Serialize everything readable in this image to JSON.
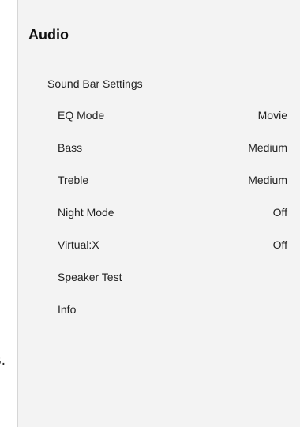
{
  "background": {
    "fragment_text": "s."
  },
  "panel": {
    "title": "Audio",
    "section_header": "Sound Bar Settings",
    "items": [
      {
        "label": "EQ Mode",
        "value": "Movie"
      },
      {
        "label": "Bass",
        "value": "Medium"
      },
      {
        "label": "Treble",
        "value": "Medium"
      },
      {
        "label": "Night Mode",
        "value": "Off"
      },
      {
        "label": "Virtual:X",
        "value": "Off"
      },
      {
        "label": "Speaker Test",
        "value": ""
      },
      {
        "label": "Info",
        "value": ""
      }
    ]
  },
  "colors": {
    "panel_background": "#f3f3f3",
    "text": "#222222",
    "title": "#111111"
  }
}
